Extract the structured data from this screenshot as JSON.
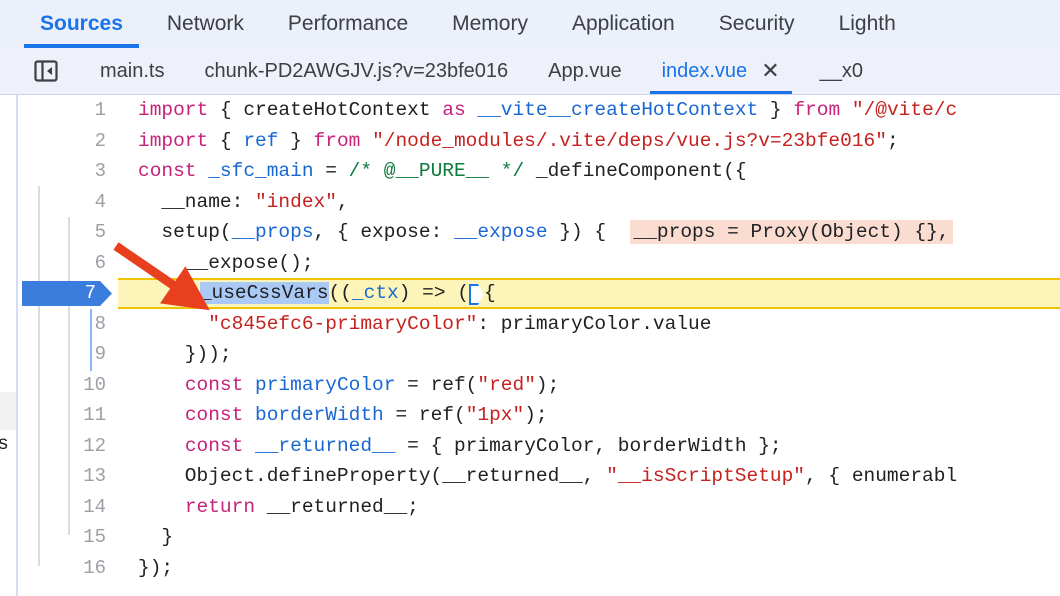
{
  "panel_tabs": [
    {
      "label": "Sources",
      "selected": true
    },
    {
      "label": "Network",
      "selected": false
    },
    {
      "label": "Performance",
      "selected": false
    },
    {
      "label": "Memory",
      "selected": false
    },
    {
      "label": "Application",
      "selected": false
    },
    {
      "label": "Security",
      "selected": false
    },
    {
      "label": "Lighth",
      "selected": false
    }
  ],
  "file_tabs": {
    "navigator_toggle_icon": "show-navigator-icon",
    "items": [
      {
        "label": "main.ts",
        "active": false,
        "closable": false
      },
      {
        "label": "chunk-PD2AWGJV.js?v=23bfe016",
        "active": false,
        "closable": false
      },
      {
        "label": "App.vue",
        "active": false,
        "closable": false
      },
      {
        "label": "index.vue",
        "active": true,
        "closable": true,
        "close_glyph": "✕"
      },
      {
        "label": "__x0",
        "active": false,
        "closable": false
      }
    ]
  },
  "navigator_sliver": {
    "clipped_text": "=s"
  },
  "editor": {
    "paused_line": 7,
    "colors": {
      "exec_line_bg": "#fcf4b8",
      "exec_line_border": "#f2c200",
      "exec_gutter": "#3b7ddd",
      "selection": "#aac9f5",
      "inline_value_bg": "#fadcd1",
      "accent": "#1a73e8",
      "annotation_arrow": "#e8401f"
    },
    "lines": [
      {
        "num": "1",
        "segments": [
          {
            "t": "import ",
            "c": "kw"
          },
          {
            "t": "{ createHotContext ",
            "c": "plain"
          },
          {
            "t": "as",
            "c": "kw"
          },
          {
            "t": " ",
            "c": "plain"
          },
          {
            "t": "__vite__createHotContext",
            "c": "var"
          },
          {
            "t": " } ",
            "c": "plain"
          },
          {
            "t": "from",
            "c": "kw"
          },
          {
            "t": " ",
            "c": "plain"
          },
          {
            "t": "\"/@vite/c",
            "c": "str"
          }
        ]
      },
      {
        "num": "2",
        "segments": [
          {
            "t": "import ",
            "c": "kw"
          },
          {
            "t": "{ ",
            "c": "plain"
          },
          {
            "t": "ref",
            "c": "var"
          },
          {
            "t": " } ",
            "c": "plain"
          },
          {
            "t": "from",
            "c": "kw"
          },
          {
            "t": " ",
            "c": "plain"
          },
          {
            "t": "\"/node_modules/.vite/deps/vue.js?v=23bfe016\"",
            "c": "str"
          },
          {
            "t": ";",
            "c": "plain"
          }
        ]
      },
      {
        "num": "3",
        "segments": [
          {
            "t": "const",
            "c": "kw"
          },
          {
            "t": " ",
            "c": "plain"
          },
          {
            "t": "_sfc_main",
            "c": "var"
          },
          {
            "t": " = ",
            "c": "plain"
          },
          {
            "t": "/* @__PURE__ */",
            "c": "com"
          },
          {
            "t": " _defineComponent({",
            "c": "plain"
          }
        ]
      },
      {
        "num": "4",
        "segments": [
          {
            "t": "  __name: ",
            "c": "plain"
          },
          {
            "t": "\"index\"",
            "c": "str"
          },
          {
            "t": ",",
            "c": "plain"
          }
        ]
      },
      {
        "num": "5",
        "segments": [
          {
            "t": "  setup(",
            "c": "plain"
          },
          {
            "t": "__props",
            "c": "var"
          },
          {
            "t": ", { expose: ",
            "c": "plain"
          },
          {
            "t": "__expose",
            "c": "var"
          },
          {
            "t": " }) {",
            "c": "plain"
          }
        ],
        "inline_value": "__props = Proxy(Object) {},"
      },
      {
        "num": "6",
        "segments": [
          {
            "t": "    __expose();",
            "c": "plain"
          }
        ]
      },
      {
        "num": "7",
        "exec": true,
        "segments": [
          {
            "t": "    ",
            "c": "plain"
          },
          {
            "t": "▶",
            "c": "step-filled"
          },
          {
            "t": "_useCssVars",
            "c": "selected"
          },
          {
            "t": "((",
            "c": "plain"
          },
          {
            "t": "_ctx",
            "c": "var"
          },
          {
            "t": ") => (",
            "c": "plain"
          },
          {
            "t": "▷",
            "c": "step-outline"
          },
          {
            "t": "{",
            "c": "plain"
          }
        ]
      },
      {
        "num": "8",
        "segments": [
          {
            "t": "      ",
            "c": "plain"
          },
          {
            "t": "\"c845efc6-primaryColor\"",
            "c": "str"
          },
          {
            "t": ": primaryColor.value",
            "c": "plain"
          }
        ]
      },
      {
        "num": "9",
        "segments": [
          {
            "t": "    }));",
            "c": "plain"
          }
        ]
      },
      {
        "num": "10",
        "segments": [
          {
            "t": "    ",
            "c": "plain"
          },
          {
            "t": "const",
            "c": "kw"
          },
          {
            "t": " ",
            "c": "plain"
          },
          {
            "t": "primaryColor",
            "c": "var"
          },
          {
            "t": " = ref(",
            "c": "plain"
          },
          {
            "t": "\"red\"",
            "c": "str"
          },
          {
            "t": ");",
            "c": "plain"
          }
        ]
      },
      {
        "num": "11",
        "segments": [
          {
            "t": "    ",
            "c": "plain"
          },
          {
            "t": "const",
            "c": "kw"
          },
          {
            "t": " ",
            "c": "plain"
          },
          {
            "t": "borderWidth",
            "c": "var"
          },
          {
            "t": " = ref(",
            "c": "plain"
          },
          {
            "t": "\"1px\"",
            "c": "str"
          },
          {
            "t": ");",
            "c": "plain"
          }
        ]
      },
      {
        "num": "12",
        "segments": [
          {
            "t": "    ",
            "c": "plain"
          },
          {
            "t": "const",
            "c": "kw"
          },
          {
            "t": " ",
            "c": "plain"
          },
          {
            "t": "__returned__",
            "c": "var"
          },
          {
            "t": " = { primaryColor, borderWidth };",
            "c": "plain"
          }
        ]
      },
      {
        "num": "13",
        "segments": [
          {
            "t": "    Object.defineProperty(__returned__, ",
            "c": "plain"
          },
          {
            "t": "\"__isScriptSetup\"",
            "c": "str"
          },
          {
            "t": ", { enumerabl",
            "c": "plain"
          }
        ]
      },
      {
        "num": "14",
        "segments": [
          {
            "t": "    ",
            "c": "plain"
          },
          {
            "t": "return",
            "c": "kw"
          },
          {
            "t": " __returned__;",
            "c": "plain"
          }
        ]
      },
      {
        "num": "15",
        "segments": [
          {
            "t": "  }",
            "c": "plain"
          }
        ]
      },
      {
        "num": "16",
        "segments": [
          {
            "t": "});",
            "c": "plain"
          }
        ]
      }
    ]
  }
}
